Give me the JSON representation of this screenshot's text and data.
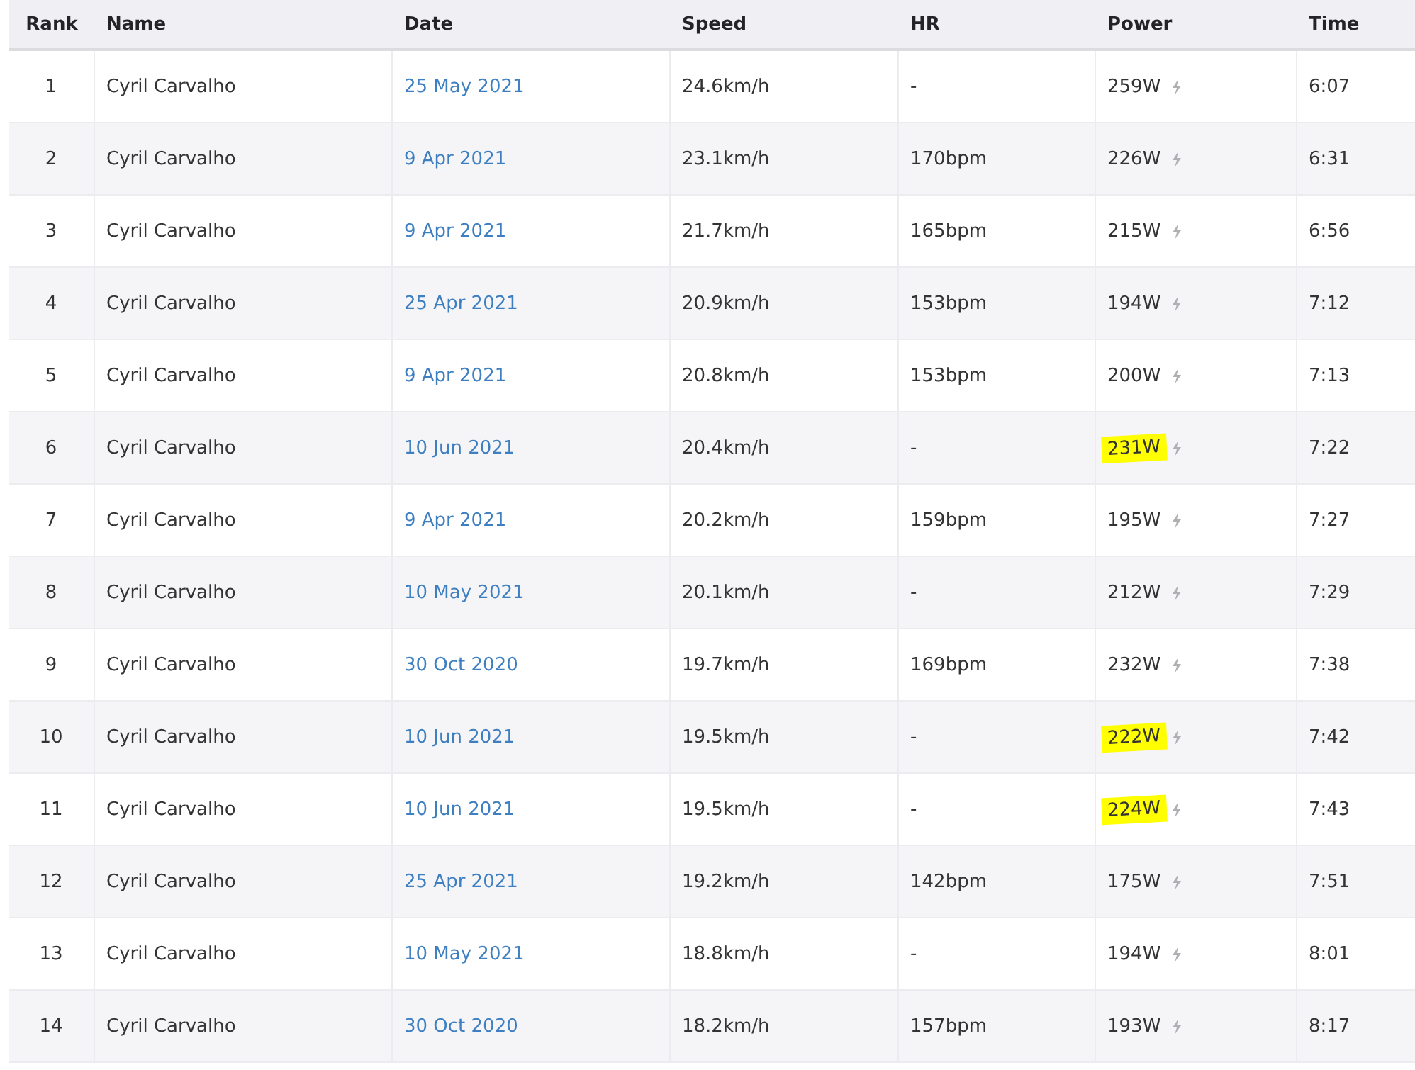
{
  "table": {
    "columns": [
      "Rank",
      "Name",
      "Date",
      "Speed",
      "HR",
      "Power",
      "Time"
    ],
    "rows": [
      {
        "rank": "1",
        "name": "Cyril Carvalho",
        "date": "25 May 2021",
        "speed": "24.6km/h",
        "hr": "-",
        "power": "259W",
        "time": "6:07",
        "highlighted": false
      },
      {
        "rank": "2",
        "name": "Cyril Carvalho",
        "date": "9 Apr 2021",
        "speed": "23.1km/h",
        "hr": "170bpm",
        "power": "226W",
        "time": "6:31",
        "highlighted": false
      },
      {
        "rank": "3",
        "name": "Cyril Carvalho",
        "date": "9 Apr 2021",
        "speed": "21.7km/h",
        "hr": "165bpm",
        "power": "215W",
        "time": "6:56",
        "highlighted": false
      },
      {
        "rank": "4",
        "name": "Cyril Carvalho",
        "date": "25 Apr 2021",
        "speed": "20.9km/h",
        "hr": "153bpm",
        "power": "194W",
        "time": "7:12",
        "highlighted": false
      },
      {
        "rank": "5",
        "name": "Cyril Carvalho",
        "date": "9 Apr 2021",
        "speed": "20.8km/h",
        "hr": "153bpm",
        "power": "200W",
        "time": "7:13",
        "highlighted": false
      },
      {
        "rank": "6",
        "name": "Cyril Carvalho",
        "date": "10 Jun 2021",
        "speed": "20.4km/h",
        "hr": "-",
        "power": "231W",
        "time": "7:22",
        "highlighted": true
      },
      {
        "rank": "7",
        "name": "Cyril Carvalho",
        "date": "9 Apr 2021",
        "speed": "20.2km/h",
        "hr": "159bpm",
        "power": "195W",
        "time": "7:27",
        "highlighted": false
      },
      {
        "rank": "8",
        "name": "Cyril Carvalho",
        "date": "10 May 2021",
        "speed": "20.1km/h",
        "hr": "-",
        "power": "212W",
        "time": "7:29",
        "highlighted": false
      },
      {
        "rank": "9",
        "name": "Cyril Carvalho",
        "date": "30 Oct 2020",
        "speed": "19.7km/h",
        "hr": "169bpm",
        "power": "232W",
        "time": "7:38",
        "highlighted": false
      },
      {
        "rank": "10",
        "name": "Cyril Carvalho",
        "date": "10 Jun 2021",
        "speed": "19.5km/h",
        "hr": "-",
        "power": "222W",
        "time": "7:42",
        "highlighted": true
      },
      {
        "rank": "11",
        "name": "Cyril Carvalho",
        "date": "10 Jun 2021",
        "speed": "19.5km/h",
        "hr": "-",
        "power": "224W",
        "time": "7:43",
        "highlighted": true
      },
      {
        "rank": "12",
        "name": "Cyril Carvalho",
        "date": "25 Apr 2021",
        "speed": "19.2km/h",
        "hr": "142bpm",
        "power": "175W",
        "time": "7:51",
        "highlighted": false
      },
      {
        "rank": "13",
        "name": "Cyril Carvalho",
        "date": "10 May 2021",
        "speed": "18.8km/h",
        "hr": "-",
        "power": "194W",
        "time": "8:01",
        "highlighted": false
      },
      {
        "rank": "14",
        "name": "Cyril Carvalho",
        "date": "30 Oct 2020",
        "speed": "18.2km/h",
        "hr": "157bpm",
        "power": "193W",
        "time": "8:17",
        "highlighted": false
      }
    ]
  }
}
